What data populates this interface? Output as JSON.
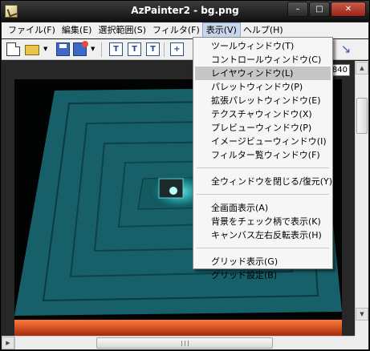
{
  "window": {
    "title": "AzPainter2 - bg.png"
  },
  "window_controls": {
    "minimize": "–",
    "maximize": "□",
    "close": "✕"
  },
  "menubar": {
    "items": [
      {
        "label": "ファイル(F)"
      },
      {
        "label": "編集(E)"
      },
      {
        "label": "選択範囲(S)"
      },
      {
        "label": "フィルタ(F)"
      },
      {
        "label": "表示(V)"
      },
      {
        "label": "ヘルプ(H)"
      }
    ]
  },
  "toolbar": {
    "box_buttons": [
      "T",
      "T",
      "T",
      "+"
    ],
    "icons": [
      "new-file-icon",
      "open-folder-icon",
      "save-icon",
      "save-as-icon",
      "text-tool-icon",
      "grid-icon",
      "rotate-icon"
    ]
  },
  "canvas": {
    "ruler_value": "840"
  },
  "view_menu": {
    "items": [
      {
        "label": "ツールウィンドウ(T)",
        "highlighted": false
      },
      {
        "label": "コントロールウィンドウ(C)",
        "highlighted": false
      },
      {
        "label": "レイヤウィンドウ(L)",
        "highlighted": true
      },
      {
        "label": "パレットウィンドウ(P)",
        "highlighted": false
      },
      {
        "label": "拡張パレットウィンドウ(E)",
        "highlighted": false
      },
      {
        "label": "テクスチャウィンドウ(X)",
        "highlighted": false
      },
      {
        "label": "プレビューウィンドウ(P)",
        "highlighted": false
      },
      {
        "label": "イメージビューウィンドウ(I)",
        "highlighted": false
      },
      {
        "label": "フィルター覧ウィンドウ(F)",
        "highlighted": false
      },
      {
        "label": "全ウィンドウを閉じる/復元(Y)",
        "highlighted": false
      },
      {
        "label": "全画面表示(A)",
        "highlighted": false
      },
      {
        "label": "背景をチェック柄で表示(K)",
        "highlighted": false
      },
      {
        "label": "キャンバス左右反転表示(H)",
        "highlighted": false
      },
      {
        "label": "グリッド表示(G)",
        "highlighted": false
      },
      {
        "label": "グリッド設定(B)",
        "highlighted": false
      }
    ]
  },
  "colors": {
    "teal": "#18606a",
    "menu_highlight": "#c6c6c6",
    "title_bar": "#1a1a1a",
    "floor": "#d0441a"
  }
}
